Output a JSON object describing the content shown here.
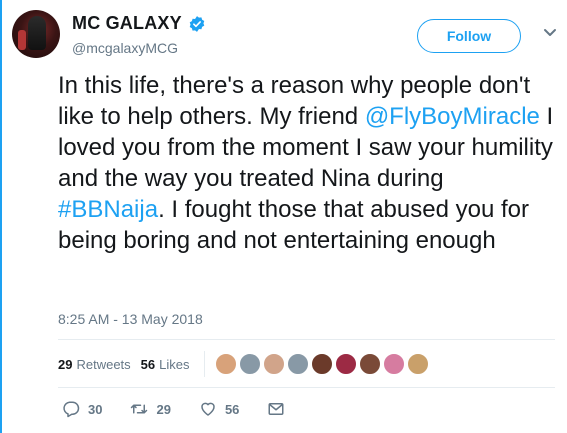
{
  "user": {
    "display_name": "MC GALAXY",
    "handle": "@mcgalaxyMCG",
    "verified": true,
    "avatar_icon": "profile-photo"
  },
  "follow_button": {
    "label": "Follow"
  },
  "menu_icon": "chevron-down-icon",
  "tweet": {
    "text_1": "In this life, there's a reason why people don't like to help others. My friend ",
    "mention": "@FlyBoyMiracle",
    "text_2": " I loved you from the moment I saw your humility and the way you treated Nina during ",
    "hashtag": "#BBNaija",
    "text_3": ". I fought those that abused you for being boring and not entertaining enough"
  },
  "timestamp": "8:25 AM - 13 May 2018",
  "stats": {
    "retweets_count": "29",
    "retweets_label": "Retweets",
    "likes_count": "56",
    "likes_label": "Likes",
    "liker_avatar_colors": [
      "#d8a27a",
      "#8899a6",
      "#d1a48a",
      "#8899a6",
      "#6b3a2a",
      "#9c2a44",
      "#7a4a38",
      "#d67ca0",
      "#c9a06a"
    ]
  },
  "actions": {
    "reply_count": "30",
    "retweet_count": "29",
    "like_count": "56"
  },
  "colors": {
    "accent": "#1da1f2",
    "secondary_text": "#657786"
  }
}
